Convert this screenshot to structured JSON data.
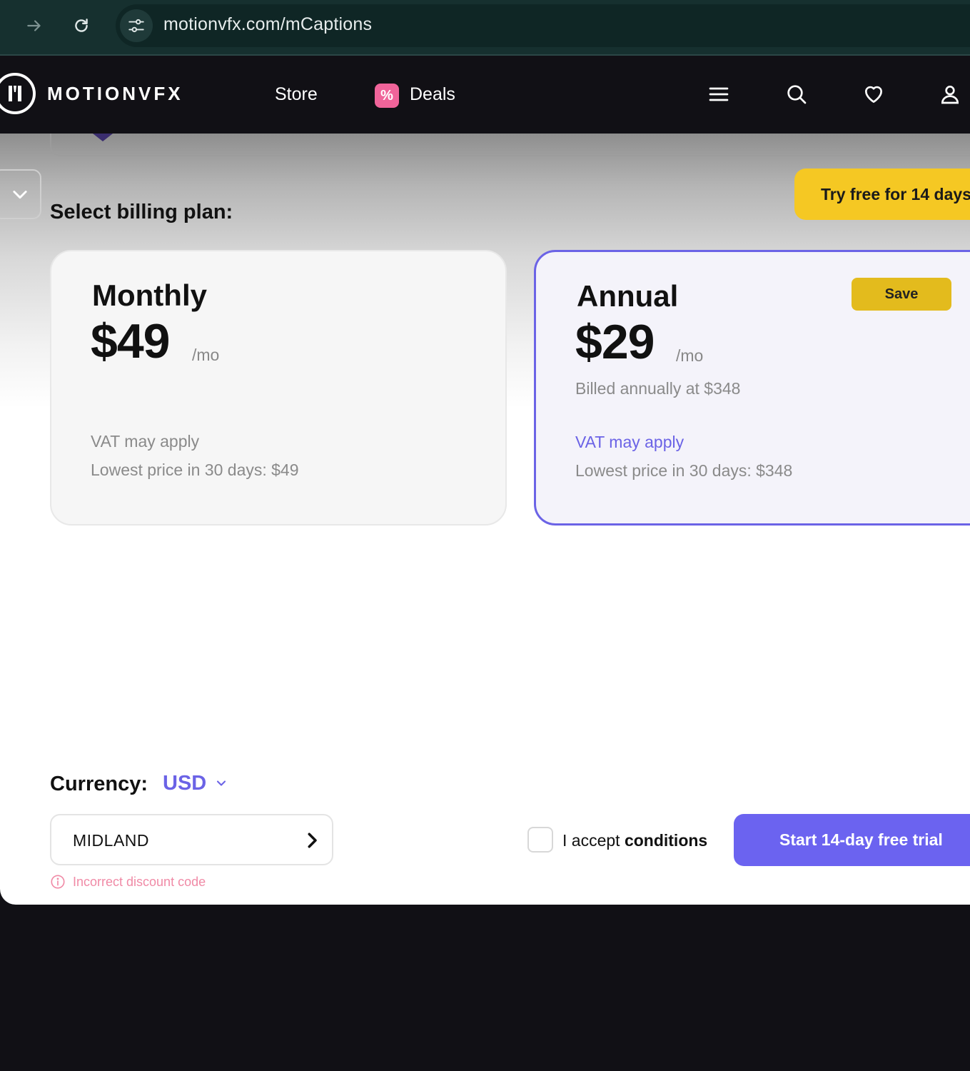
{
  "browser": {
    "url": "motionvfx.com/mCaptions"
  },
  "header": {
    "logo_text": "MOTIONVFX",
    "nav": {
      "store": "Store",
      "deals_badge": "%",
      "deals": "Deals"
    }
  },
  "billing": {
    "title": "Select billing plan:",
    "trial_top_button": "Try free for 14 days",
    "plans": [
      {
        "name": "Monthly",
        "price": "$49",
        "unit": "/mo",
        "billed": "",
        "vat": "VAT may apply",
        "lowest": "Lowest price in 30 days: $49",
        "selected": false
      },
      {
        "name": "Annual",
        "price": "$29",
        "unit": "/mo",
        "billed": "Billed annually at $348",
        "vat": "VAT may apply",
        "lowest": "Lowest price in 30 days: $348",
        "badge": "Save",
        "selected": true
      }
    ]
  },
  "checkout": {
    "currency_label": "Currency:",
    "currency_value": "USD",
    "discount_code": "MIDLAND",
    "discount_error": "Incorrect discount code",
    "accept_prefix": "I accept ",
    "accept_link": "conditions",
    "start_trial_button": "Start 14-day free trial"
  },
  "colors": {
    "accent": "#6b63e6",
    "cta": "#6b63f0",
    "yellow": "#f5c823",
    "deals_pink": "#f0649a",
    "error": "#f08aa6",
    "header_bg": "#111015",
    "browser_bg": "#16302f"
  },
  "icons": [
    "forward-icon",
    "reload-icon",
    "site-settings-icon",
    "logo-mark-icon",
    "percent-icon",
    "hamburger-menu-icon",
    "search-icon",
    "heart-icon",
    "user-icon",
    "chevron-down-icon",
    "chevron-right-icon",
    "info-icon"
  ]
}
